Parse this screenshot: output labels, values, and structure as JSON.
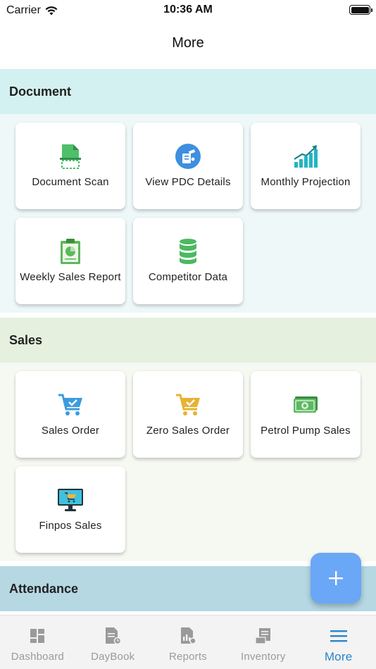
{
  "status": {
    "carrier": "Carrier",
    "time": "10:36 AM"
  },
  "nav": {
    "title": "More"
  },
  "sections": {
    "document": {
      "title": "Document",
      "tiles": [
        {
          "label": "Document Scan",
          "icon": "document-scan-icon"
        },
        {
          "label": "View PDC Details",
          "icon": "pdc-details-icon"
        },
        {
          "label": "Monthly Projection",
          "icon": "growth-chart-icon"
        },
        {
          "label": "Weekly Sales Report",
          "icon": "clipboard-report-icon"
        },
        {
          "label": "Competitor Data",
          "icon": "database-icon"
        }
      ]
    },
    "sales": {
      "title": "Sales",
      "tiles": [
        {
          "label": "Sales Order",
          "icon": "shopping-cart-icon"
        },
        {
          "label": "Zero Sales Order",
          "icon": "shopping-cart-icon"
        },
        {
          "label": "Petrol Pump Sales",
          "icon": "cash-icon"
        },
        {
          "label": "Finpos Sales",
          "icon": "pos-monitor-icon"
        }
      ]
    },
    "attendance": {
      "title": "Attendance"
    }
  },
  "tabs": [
    {
      "label": "Dashboard",
      "icon": "dashboard-icon",
      "active": false
    },
    {
      "label": "DayBook",
      "icon": "daybook-icon",
      "active": false
    },
    {
      "label": "Reports",
      "icon": "reports-icon",
      "active": false
    },
    {
      "label": "Inventory",
      "icon": "inventory-icon",
      "active": false
    },
    {
      "label": "More",
      "icon": "menu-icon",
      "active": true
    }
  ],
  "colors": {
    "accent": "#2a86c9",
    "fab": "#6aa7f7",
    "document_header": "#d3f1f0",
    "sales_header": "#e5f1de",
    "attendance_header": "#b5d8e3"
  }
}
